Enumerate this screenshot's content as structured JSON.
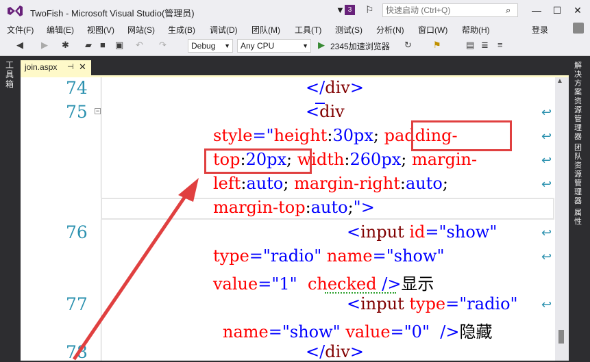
{
  "window": {
    "title": "TwoFish - Microsoft Visual Studio(管理员)",
    "notification_count": "3",
    "quick_launch_placeholder": "快速启动 (Ctrl+Q)",
    "controls": {
      "minimize": "—",
      "maximize": "☐",
      "close": "✕"
    }
  },
  "menu": {
    "items": [
      "文件(F)",
      "编辑(E)",
      "视图(V)",
      "网站(S)",
      "生成(B)",
      "调试(D)",
      "团队(M)",
      "工具(T)",
      "测试(S)",
      "分析(N)",
      "窗口(W)",
      "帮助(H)"
    ],
    "login": "登录"
  },
  "toolbar": {
    "config": "Debug",
    "platform": "Any CPU",
    "browser": "2345加速浏览器"
  },
  "left_panel": {
    "label": "工具箱"
  },
  "right_panel": {
    "labels": [
      "解决方案资源管理器",
      "团队资源管理器",
      "属性"
    ]
  },
  "tab": {
    "name": "join.aspx",
    "pin": "⊣",
    "close": "✕"
  },
  "editor": {
    "line_numbers": [
      "74",
      "75",
      "76",
      "77",
      "78"
    ],
    "code": {
      "l1": {
        "a": "</",
        "b": "div",
        "c": ">"
      },
      "l2": {
        "a": "<",
        "b": "div"
      },
      "l3": {
        "a": "style",
        "b": "=\"",
        "c": "height",
        "d": ":",
        "e": "30px",
        "f": ";",
        "g": "padding-"
      },
      "l4": {
        "a": "top",
        "b": ":",
        "c": "20px",
        "d": ";",
        "e": "width",
        "f": ":",
        "g": "260px",
        "h": ";",
        "i": "margin-"
      },
      "l5": {
        "a": "left",
        "b": ":",
        "c": "auto",
        "d": ";",
        "e": "margin-right",
        "f": ":",
        "g": "auto",
        "h": ";"
      },
      "l6": {
        "a": "margin-top",
        "b": ":",
        "c": "auto",
        "d": ";",
        "e": "\">"
      },
      "l7": {
        "a": "<",
        "b": "input",
        "c": "id",
        "d": "=\"show\""
      },
      "l8": {
        "a": "type",
        "b": "=\"radio\"",
        "c": "name",
        "d": "=\"show\""
      },
      "l9": {
        "a": "value",
        "b": "=\"1\"",
        "c": "checked",
        "d": "/>",
        "e": "显示"
      },
      "l10": {
        "a": "<",
        "b": "input",
        "c": "type",
        "d": "=\"radio\""
      },
      "l11": {
        "a": "name",
        "b": "=\"show\"",
        "c": "value",
        "d": "=\"0\"",
        "e": "/>",
        "f": "隐藏"
      },
      "l12": {
        "a": "</",
        "b": "div",
        "c": ">"
      }
    }
  }
}
